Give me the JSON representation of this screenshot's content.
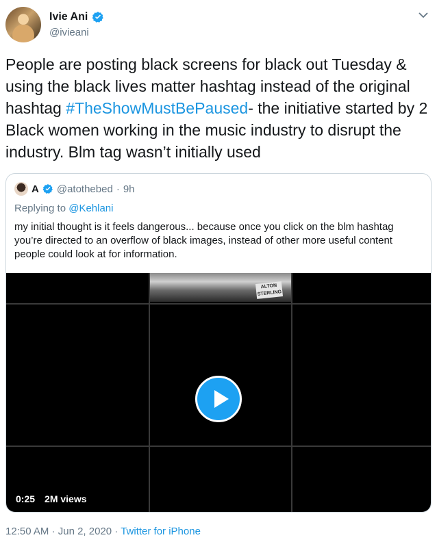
{
  "author": {
    "display_name": "Ivie Ani",
    "handle": "@ivieani",
    "verified": true
  },
  "tweet": {
    "text_before": "People are posting black screens for black out Tuesday & using the black lives matter hashtag instead of the original hashtag ",
    "hashtag": "#TheShowMustBePaused",
    "text_after": "- the initiative started by 2 Black women working in the music industry to disrupt the industry. Blm tag wasn’t initially used"
  },
  "quoted_tweet": {
    "display_name": "A",
    "handle": "@atothebed",
    "separator": "·",
    "time": "9h",
    "reply_prefix": "Replying to ",
    "reply_to": "@Kehlani",
    "text": "my initial thought is it feels dangerous... because once you click on the blm hashtag you’re directed to an overflow of black images, instead of other more useful content people could look at for information.",
    "video": {
      "sign_text": "ALTON STERLING",
      "duration": "0:25",
      "views": "2M views"
    }
  },
  "footer": {
    "time": "12:50 AM",
    "sep1": " · ",
    "date": "Jun 2, 2020",
    "sep2": " · ",
    "source": "Twitter for iPhone"
  },
  "icons": {
    "verified": "verified-badge-icon",
    "chevron": "chevron-down-icon",
    "play": "play-icon"
  },
  "colors": {
    "link": "#1b95e0",
    "play_button": "#1da1f2",
    "muted": "#657786"
  }
}
